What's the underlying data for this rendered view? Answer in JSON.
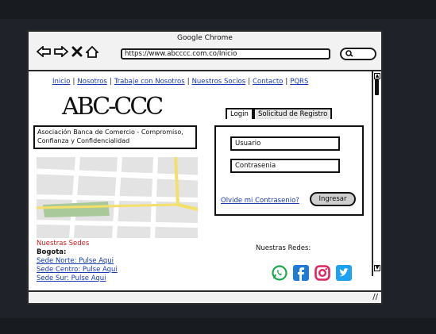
{
  "window": {
    "title": "Google Chrome"
  },
  "address_bar": {
    "url": "https://www.abcccc.com.co/Inicio"
  },
  "nav_links": [
    "Inicio",
    "Nosotros",
    "Trabaje con Nosotros",
    "Nuestros Socios",
    "Contacto",
    "PQRS"
  ],
  "logo": "ABC-CCC",
  "tagline": "Asociación Banca de Comercio - Compromiso, Confianza y Confidencialidad",
  "tabs": {
    "login": "Login",
    "register": "Solicitud de Registro"
  },
  "login_form": {
    "user_placeholder": "Usuario",
    "password_placeholder": "Contrasenia",
    "forgot": "Olvide mi Contrasenio?",
    "submit": "Ingresar"
  },
  "sedes": {
    "title": "Nuestras Sedes",
    "city": "Bogota:",
    "links": [
      "Sede Norte: Pulse Aqui",
      "Sede Centro: Pulse Aqui",
      "Sede Sur: Pulse Aqui"
    ]
  },
  "social": {
    "label": "Nuestras Redes:",
    "icons": [
      "whatsapp-icon",
      "facebook-icon",
      "instagram-icon",
      "twitter-icon"
    ]
  },
  "colors": {
    "link": "#1a3ab8",
    "sedes_title": "#cc1b1b",
    "map_road": "#f4df6a",
    "map_park": "#a9c99a",
    "social_green": "#1fa84a",
    "social_blue": "#1f7ad9"
  }
}
